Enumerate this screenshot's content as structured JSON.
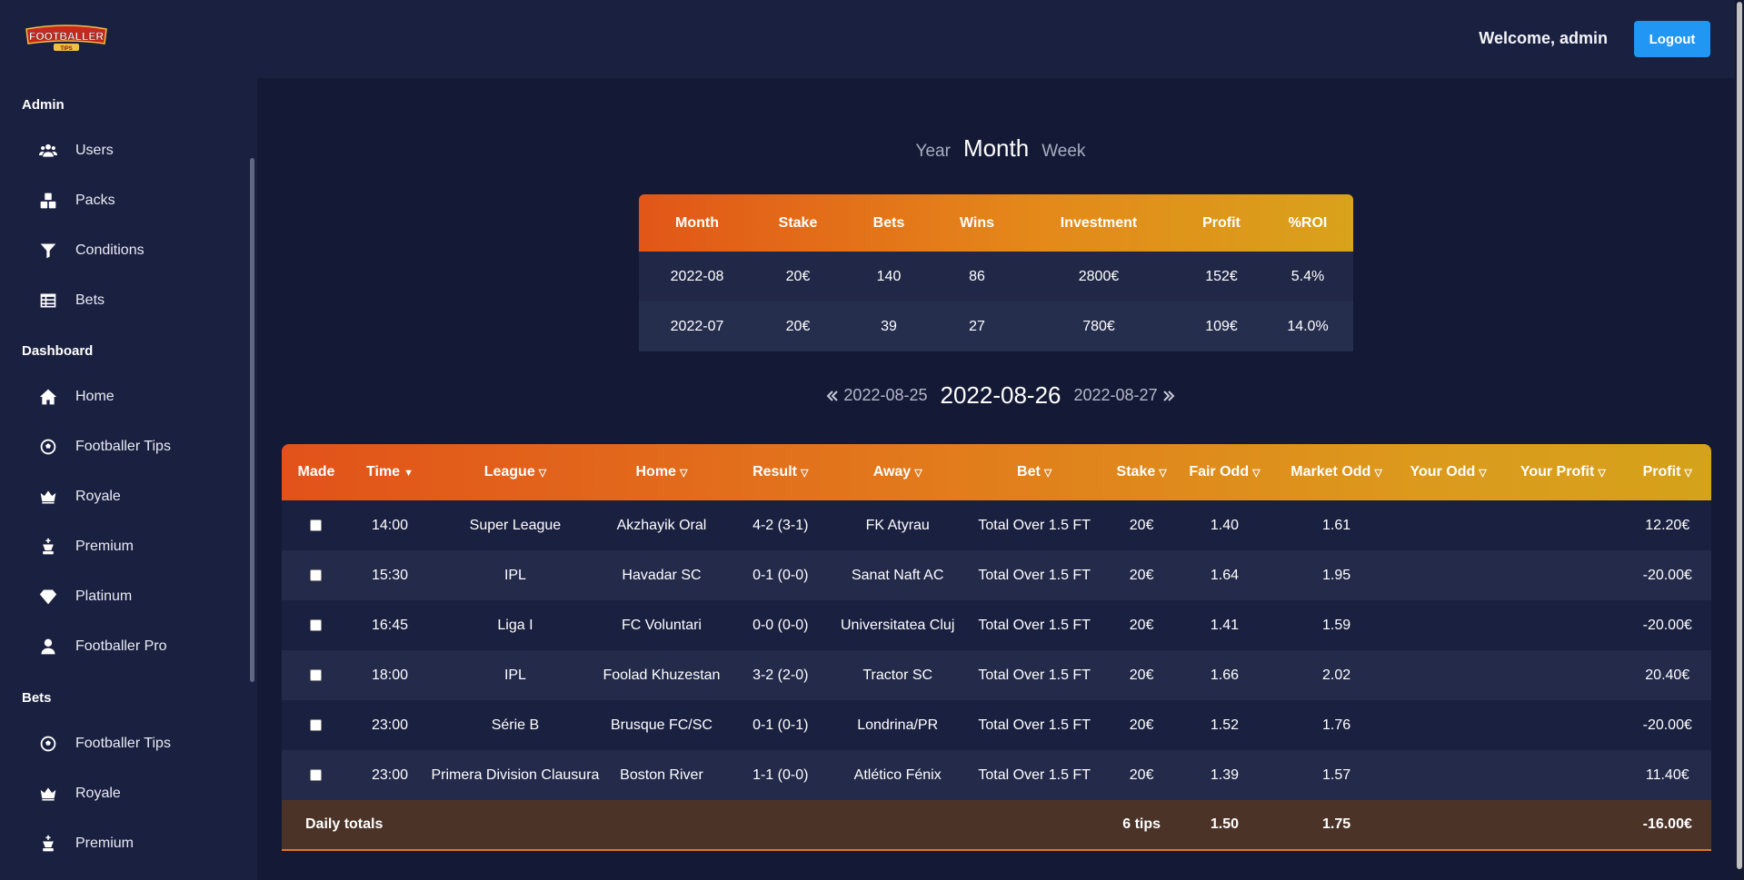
{
  "header": {
    "logo_text": "FOOTBALLER",
    "logo_sub": "TIPS",
    "welcome": "Welcome, admin",
    "logout_label": "Logout"
  },
  "sidebar": {
    "sections": [
      {
        "title": "Admin",
        "items": [
          {
            "label": "Users",
            "icon": "users-icon"
          },
          {
            "label": "Packs",
            "icon": "boxes-icon"
          },
          {
            "label": "Conditions",
            "icon": "filter-icon"
          },
          {
            "label": "Bets",
            "icon": "table-list-icon"
          }
        ]
      },
      {
        "title": "Dashboard",
        "items": [
          {
            "label": "Home",
            "icon": "home-icon"
          },
          {
            "label": "Footballer Tips",
            "icon": "football-icon"
          },
          {
            "label": "Royale",
            "icon": "crown-icon"
          },
          {
            "label": "Premium",
            "icon": "chess-king-icon"
          },
          {
            "label": "Platinum",
            "icon": "gem-icon"
          },
          {
            "label": "Footballer Pro",
            "icon": "user-icon"
          }
        ]
      },
      {
        "title": "Bets",
        "items": [
          {
            "label": "Footballer Tips",
            "icon": "football-icon"
          },
          {
            "label": "Royale",
            "icon": "crown-icon"
          },
          {
            "label": "Premium",
            "icon": "chess-king-icon"
          }
        ]
      }
    ]
  },
  "period": {
    "year": "Year",
    "month": "Month",
    "week": "Week",
    "selected": "Month"
  },
  "summary": {
    "headers": [
      "Month",
      "Stake",
      "Bets",
      "Wins",
      "Investment",
      "Profit",
      "%ROI"
    ],
    "rows": [
      [
        "2022-08",
        "20€",
        "140",
        "86",
        "2800€",
        "152€",
        "5.4%"
      ],
      [
        "2022-07",
        "20€",
        "39",
        "27",
        "780€",
        "109€",
        "14.0%"
      ]
    ]
  },
  "daynav": {
    "prev": "2022-08-25",
    "current": "2022-08-26",
    "next": "2022-08-27"
  },
  "bets": {
    "headers": {
      "made": "Made",
      "time": "Time",
      "league": "League",
      "home": "Home",
      "result": "Result",
      "away": "Away",
      "bet": "Bet",
      "stake": "Stake",
      "fair_odd": "Fair Odd",
      "market_odd": "Market Odd",
      "your_odd": "Your Odd",
      "your_profit": "Your Profit",
      "profit": "Profit"
    },
    "sort_active": "▼",
    "sort_inactive": "▽",
    "rows": [
      {
        "time": "14:00",
        "league": "Super League",
        "home": "Akzhayik Oral",
        "result": "4-2 (3-1)",
        "away": "FK Atyrau",
        "bet": "Total Over 1.5 FT",
        "stake": "20€",
        "fair_odd": "1.40",
        "market_odd": "1.61",
        "your_odd": "",
        "your_profit": "",
        "profit": "12.20€",
        "win": true
      },
      {
        "time": "15:30",
        "league": "IPL",
        "home": "Havadar SC",
        "result": "0-1 (0-0)",
        "away": "Sanat Naft AC",
        "bet": "Total Over 1.5 FT",
        "stake": "20€",
        "fair_odd": "1.64",
        "market_odd": "1.95",
        "your_odd": "",
        "your_profit": "",
        "profit": "-20.00€",
        "win": false
      },
      {
        "time": "16:45",
        "league": "Liga I",
        "home": "FC Voluntari",
        "result": "0-0 (0-0)",
        "away": "Universitatea Cluj",
        "bet": "Total Over 1.5 FT",
        "stake": "20€",
        "fair_odd": "1.41",
        "market_odd": "1.59",
        "your_odd": "",
        "your_profit": "",
        "profit": "-20.00€",
        "win": false
      },
      {
        "time": "18:00",
        "league": "IPL",
        "home": "Foolad Khuzestan",
        "result": "3-2 (2-0)",
        "away": "Tractor SC",
        "bet": "Total Over 1.5 FT",
        "stake": "20€",
        "fair_odd": "1.66",
        "market_odd": "2.02",
        "your_odd": "",
        "your_profit": "",
        "profit": "20.40€",
        "win": true
      },
      {
        "time": "23:00",
        "league": "Série B",
        "home": "Brusque FC/SC",
        "result": "0-1 (0-1)",
        "away": "Londrina/PR",
        "bet": "Total Over 1.5 FT",
        "stake": "20€",
        "fair_odd": "1.52",
        "market_odd": "1.76",
        "your_odd": "",
        "your_profit": "",
        "profit": "-20.00€",
        "win": false
      },
      {
        "time": "23:00",
        "league": "Primera Division Clausura",
        "home": "Boston River",
        "result": "1-1 (0-0)",
        "away": "Atlético Fénix",
        "bet": "Total Over 1.5 FT",
        "stake": "20€",
        "fair_odd": "1.39",
        "market_odd": "1.57",
        "your_odd": "",
        "your_profit": "",
        "profit": "11.40€",
        "win": true
      }
    ],
    "totals": {
      "label": "Daily totals",
      "tips": "6 tips",
      "fair_odd": "1.50",
      "market_odd": "1.75",
      "profit": "-16.00€"
    }
  },
  "colors": {
    "background": "#141a35",
    "panel": "#1a2040",
    "accent_start": "#e2521a",
    "accent_end": "#d4a21b",
    "logout_blue": "#2196f3",
    "profit_positive": "#35e04c",
    "profit_negative": "#ff3b3b"
  }
}
